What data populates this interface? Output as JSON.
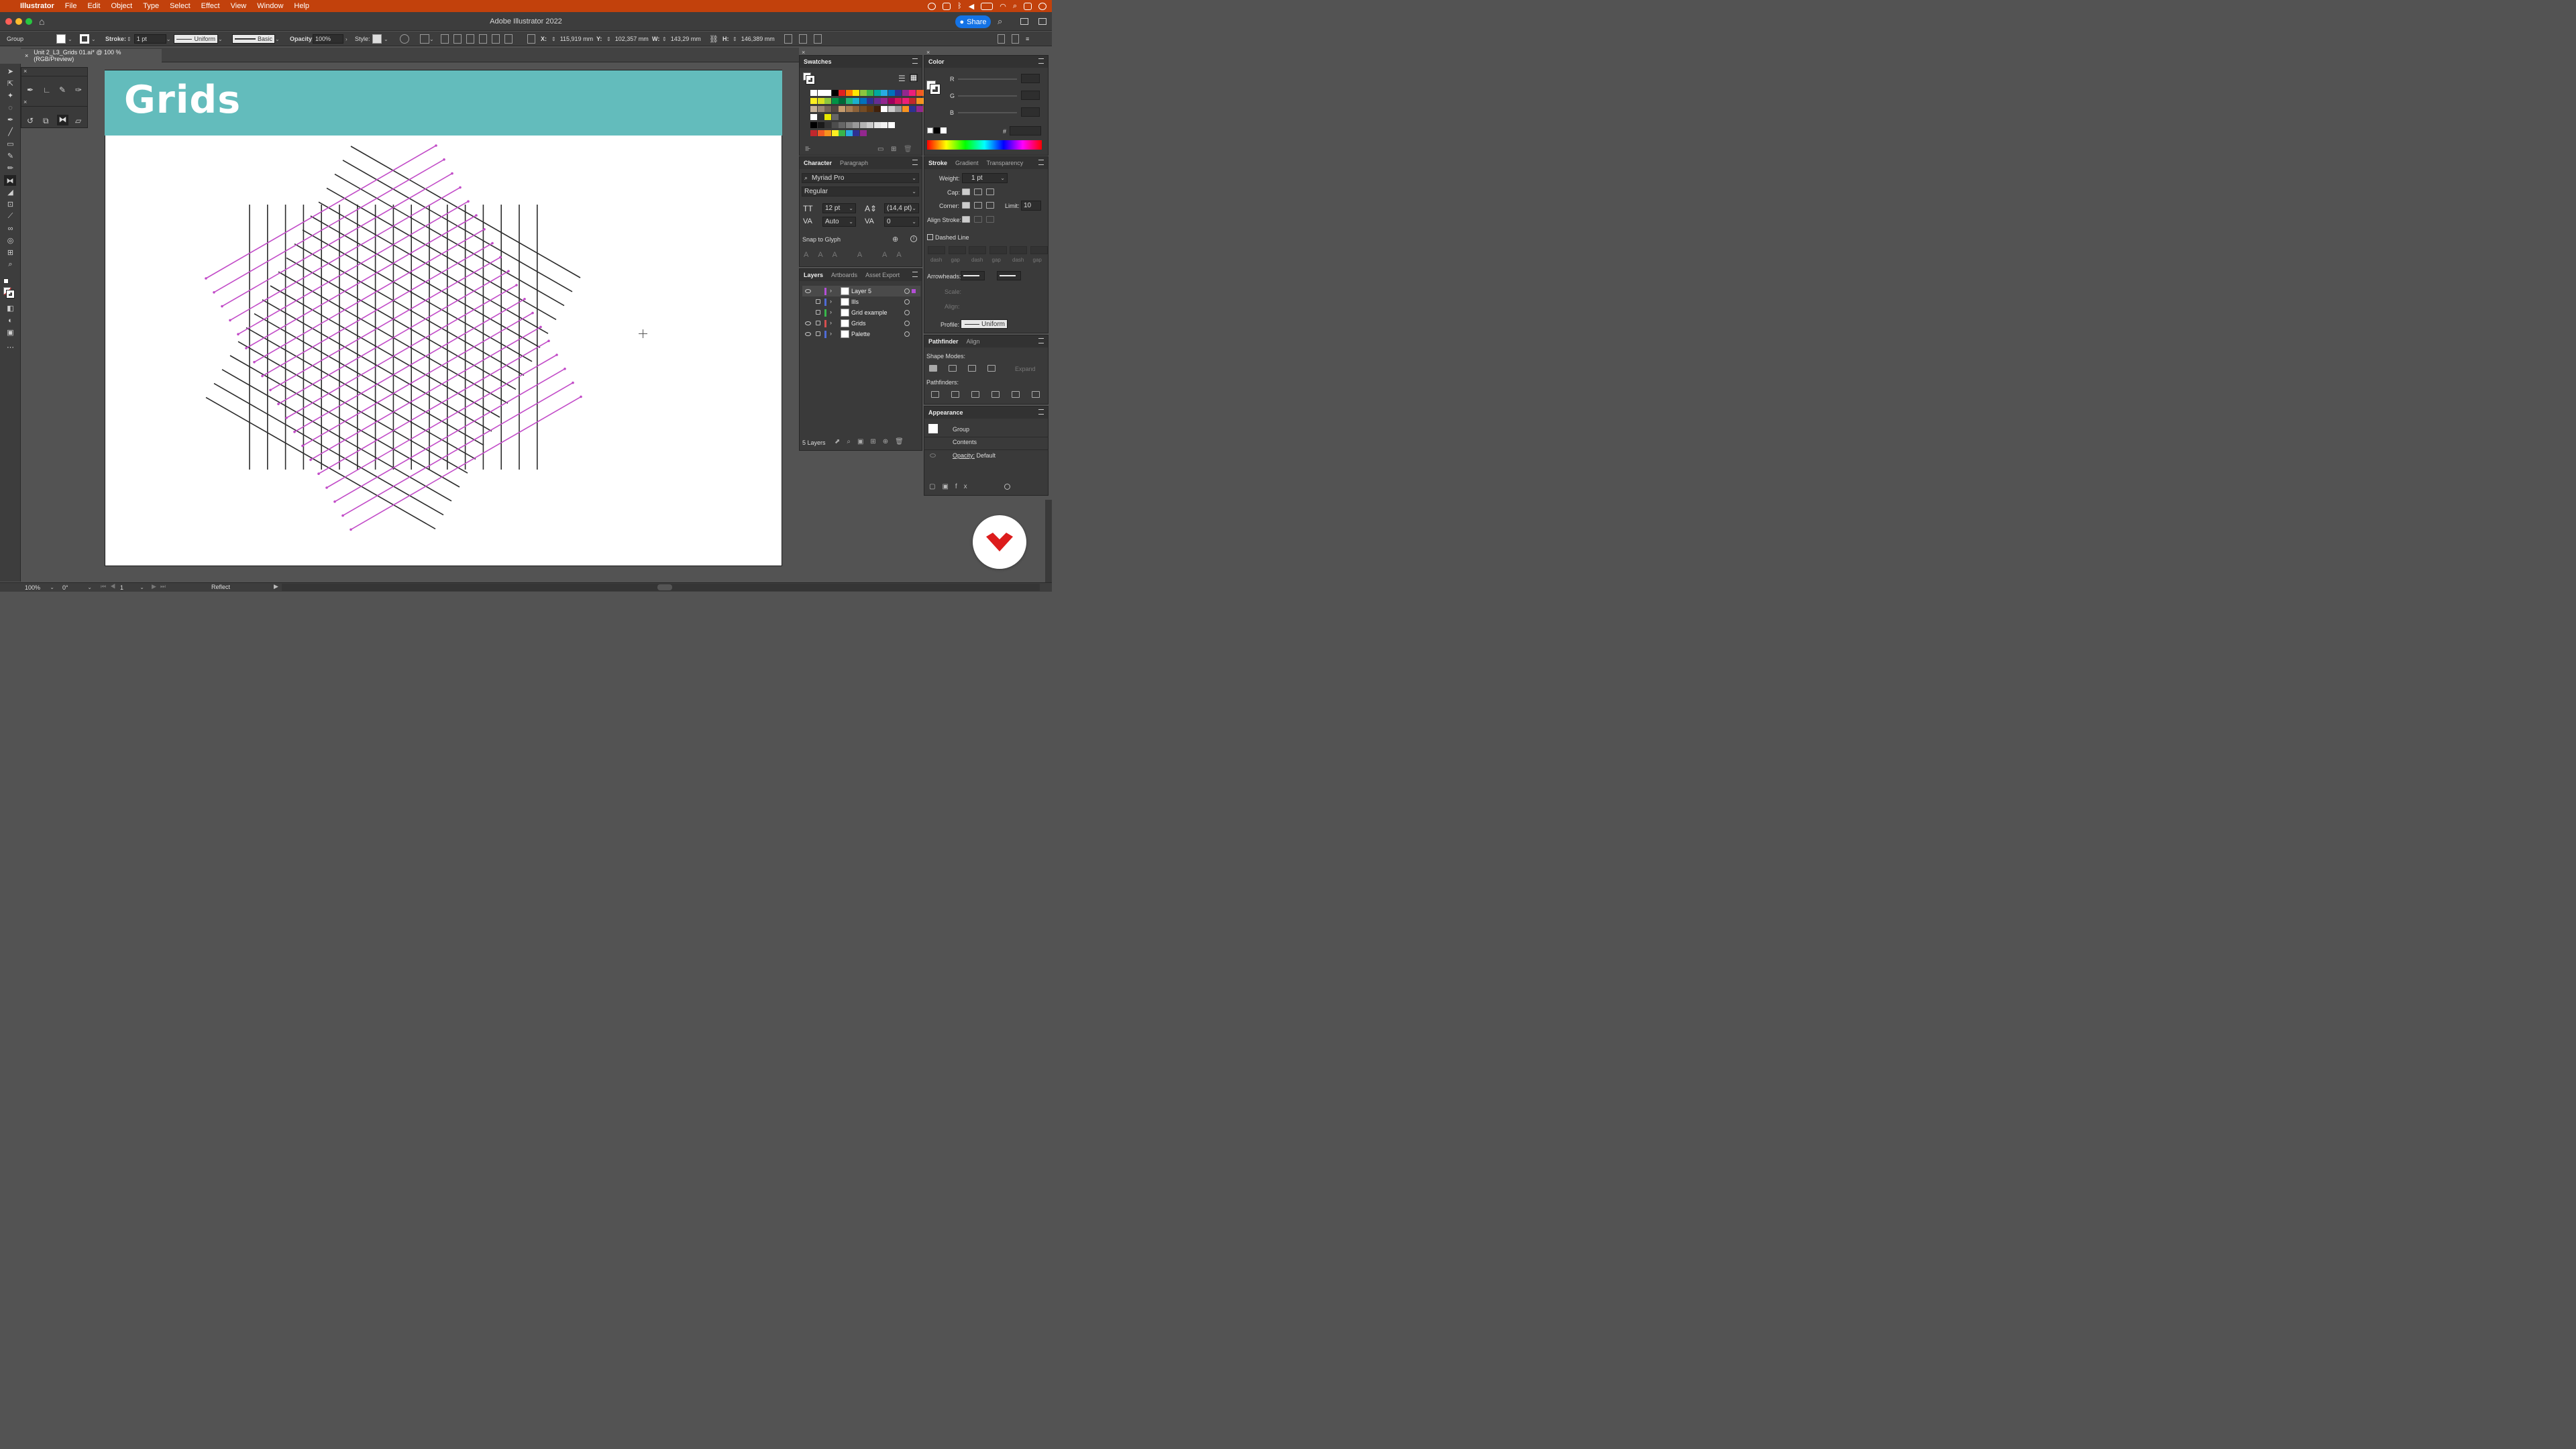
{
  "menubar": {
    "app": "Illustrator",
    "items": [
      "File",
      "Edit",
      "Object",
      "Type",
      "Select",
      "Effect",
      "View",
      "Window",
      "Help"
    ]
  },
  "window": {
    "title": "Adobe Illustrator 2022",
    "share_label": "Share"
  },
  "controlbar": {
    "selection": "Group",
    "stroke_label": "Stroke:",
    "stroke_weight": "1 pt",
    "profile": "Uniform",
    "brush": "Basic",
    "opacity_label": "Opacity:",
    "opacity_value": "100%",
    "style_label": "Style:",
    "x_label": "X:",
    "x_value": "115,919 mm",
    "y_label": "Y:",
    "y_value": "102,357 mm",
    "w_label": "W:",
    "w_value": "143,29 mm",
    "h_label": "H:",
    "h_value": "146,389 mm"
  },
  "document": {
    "tab_title": "Unit 2_L3_Grids 01.ai* @ 100 % (RGB/Preview)",
    "close": "×"
  },
  "artboard": {
    "banner_title": "Grids"
  },
  "swatches_panel": {
    "title": "Swatches"
  },
  "character_panel": {
    "tabs": [
      "Character",
      "Paragraph"
    ],
    "font": "Myriad Pro",
    "style": "Regular",
    "size": "12 pt",
    "leading": "(14,4 pt)",
    "kerning": "Auto",
    "tracking": "0",
    "snap_label": "Snap to Glyph"
  },
  "layers_panel": {
    "tabs": [
      "Layers",
      "Artboards",
      "Asset Export"
    ],
    "layers": [
      {
        "name": "Layer 5",
        "color": "#b44fd6"
      },
      {
        "name": "Ills",
        "color": "#4f6bd6"
      },
      {
        "name": "Grid example",
        "color": "#37b84a"
      },
      {
        "name": "Grids",
        "color": "#d64f4f"
      },
      {
        "name": "Palette",
        "color": "#4f6bd6"
      }
    ],
    "count": "5 Layers"
  },
  "color_panel": {
    "title": "Color",
    "r": "R",
    "g": "G",
    "b": "B",
    "hash": "#"
  },
  "stroke_panel": {
    "tabs": [
      "Stroke",
      "Gradient",
      "Transparency"
    ],
    "weight_label": "Weight:",
    "weight_value": "1 pt",
    "cap_label": "Cap:",
    "corner_label": "Corner:",
    "limit_label": "Limit:",
    "limit_value": "10",
    "align_label": "Align Stroke:",
    "dashed_label": "Dashed Line",
    "dash_labels": [
      "dash",
      "gap",
      "dash",
      "gap",
      "dash",
      "gap"
    ],
    "arrowheads_label": "Arrowheads:",
    "scale_label": "Scale:",
    "align2_label": "Align:",
    "profile_label": "Profile:",
    "profile_value": "Uniform"
  },
  "pathfinder_panel": {
    "tabs": [
      "Pathfinder",
      "Align"
    ],
    "shape_modes": "Shape Modes:",
    "expand": "Expand",
    "pathfinders": "Pathfinders:"
  },
  "appearance_panel": {
    "title": "Appearance",
    "group": "Group",
    "contents": "Contents",
    "opacity_label": "Opacity:",
    "opacity_value": "Default"
  },
  "statusbar": {
    "zoom": "100%",
    "rotation": "0°",
    "artboard": "1",
    "tool": "Reflect"
  },
  "colors": {
    "menubar": "#c2410c",
    "banner": "#63bcbc",
    "grid_magenta": "#c24cc8",
    "grid_dark": "#2b2b2b",
    "share": "#1473e6"
  }
}
